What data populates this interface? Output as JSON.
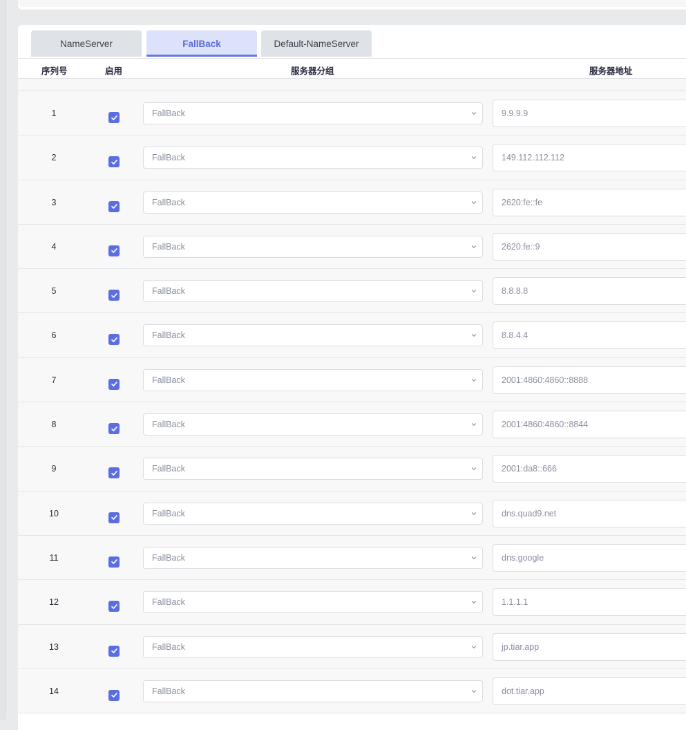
{
  "tabs": [
    {
      "label": "NameServer",
      "active": false
    },
    {
      "label": "FallBack",
      "active": true
    },
    {
      "label": "Default-NameServer",
      "active": false
    }
  ],
  "table": {
    "columns": {
      "seq": "序列号",
      "enabled": "启用",
      "group": "服务器分组",
      "address": "服务器地址"
    },
    "rows": [
      {
        "seq": "1",
        "enabled": true,
        "group": "FallBack",
        "address": "9.9.9.9"
      },
      {
        "seq": "2",
        "enabled": true,
        "group": "FallBack",
        "address": "149.112.112.112"
      },
      {
        "seq": "3",
        "enabled": true,
        "group": "FallBack",
        "address": "2620:fe::fe"
      },
      {
        "seq": "4",
        "enabled": true,
        "group": "FallBack",
        "address": "2620:fe::9"
      },
      {
        "seq": "5",
        "enabled": true,
        "group": "FallBack",
        "address": "8.8.8.8"
      },
      {
        "seq": "6",
        "enabled": true,
        "group": "FallBack",
        "address": "8.8.4.4"
      },
      {
        "seq": "7",
        "enabled": true,
        "group": "FallBack",
        "address": "2001:4860:4860::8888"
      },
      {
        "seq": "8",
        "enabled": true,
        "group": "FallBack",
        "address": "2001:4860:4860::8844"
      },
      {
        "seq": "9",
        "enabled": true,
        "group": "FallBack",
        "address": "2001:da8::666"
      },
      {
        "seq": "10",
        "enabled": true,
        "group": "FallBack",
        "address": "dns.quad9.net"
      },
      {
        "seq": "11",
        "enabled": true,
        "group": "FallBack",
        "address": "dns.google"
      },
      {
        "seq": "12",
        "enabled": true,
        "group": "FallBack",
        "address": "1.1.1.1"
      },
      {
        "seq": "13",
        "enabled": true,
        "group": "FallBack",
        "address": "jp.tiar.app"
      },
      {
        "seq": "14",
        "enabled": true,
        "group": "FallBack",
        "address": "dot.tiar.app"
      }
    ]
  },
  "colors": {
    "accent": "#5b6ee1",
    "active_tab_bg": "#dde2fb",
    "inactive_tab_bg": "#dfe3e7"
  }
}
